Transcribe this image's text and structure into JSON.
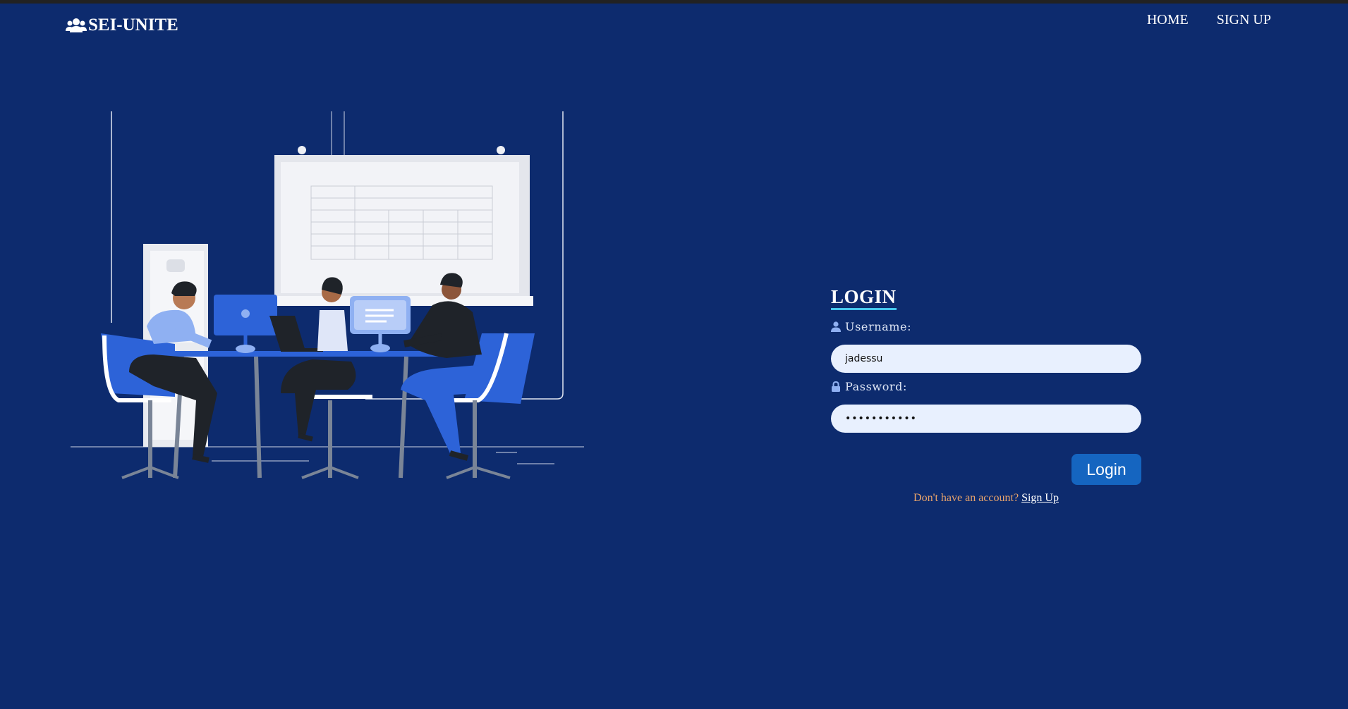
{
  "brand": {
    "name": "SEI-UNITE",
    "icon": "users-icon"
  },
  "nav": {
    "home": "HOME",
    "signup": "SIGN UP"
  },
  "illustration": {
    "icon": "team-meeting-illustration"
  },
  "login": {
    "title": "LOGIN",
    "username_label": "Username:",
    "username_icon": "user-icon",
    "username_value": "jadessu",
    "password_label": "Password:",
    "password_icon": "lock-icon",
    "password_value": "•••••••••••",
    "button_label": "Login",
    "no_account_text": "Don't have an account?",
    "signup_link": "Sign Up"
  },
  "colors": {
    "background": "#0d2b6e",
    "accent_underline": "#46c7ee",
    "button": "#1565c0",
    "input_bg": "#e8f0fe",
    "prompt_text": "#e8a36b"
  }
}
